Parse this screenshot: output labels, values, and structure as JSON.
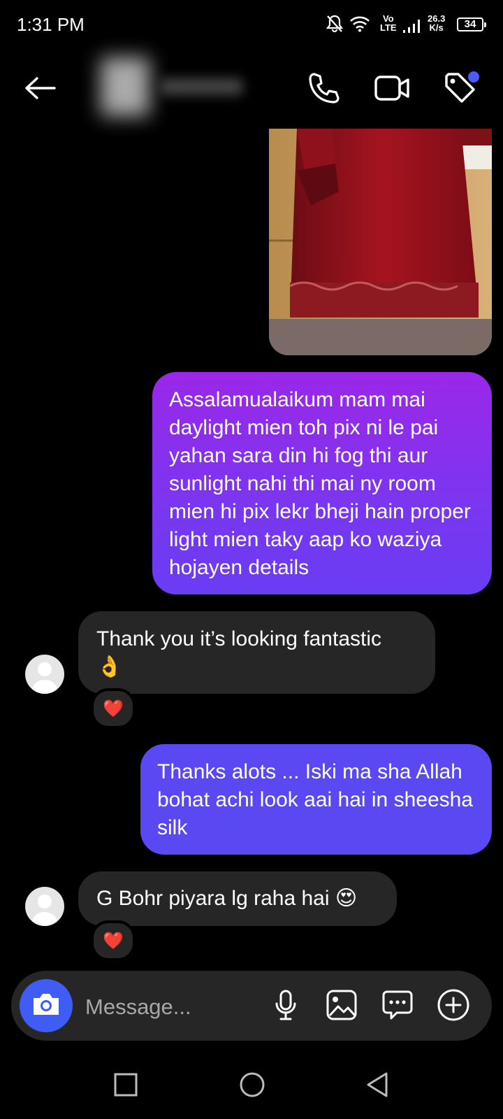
{
  "status_bar": {
    "time": "1:31 PM",
    "volte_top": "Vo",
    "volte_bottom": "LTE",
    "net_speed_value": "26.3",
    "net_speed_unit": "K/s",
    "battery": "34"
  },
  "header": {
    "back_icon": "arrow-left-icon",
    "call_icon": "phone-icon",
    "video_icon": "video-camera-icon",
    "tag_icon": "tag-icon",
    "tag_dot_color": "#4a5cf6"
  },
  "messages": [
    {
      "direction": "sent",
      "text": "Assalamualaikum mam mai daylight mien toh pix ni le pai yahan sara din hi fog thi aur sunlight nahi thi mai ny room mien hi pix lekr bheji hain proper light mien taky aap ko waziya hojayen details"
    },
    {
      "direction": "received",
      "text": "Thank you it’s looking fantastic",
      "emoji": "👌",
      "reaction": "❤️"
    },
    {
      "direction": "sent",
      "text": "Thanks alots ... Iski ma sha Allah bohat achi look aai hai in sheesha silk"
    },
    {
      "direction": "received",
      "text": "G Bohr piyara lg raha hai",
      "emoji": "😍",
      "reaction": "❤️"
    }
  ],
  "composer": {
    "placeholder": "Message...",
    "camera_color": "#3f5cf5"
  },
  "colors": {
    "sent_gradient_top": "#9b27e8",
    "sent_gradient_bottom": "#6a3cf4",
    "sent_solid": "#5a48f2",
    "received_bubble": "#262626"
  }
}
